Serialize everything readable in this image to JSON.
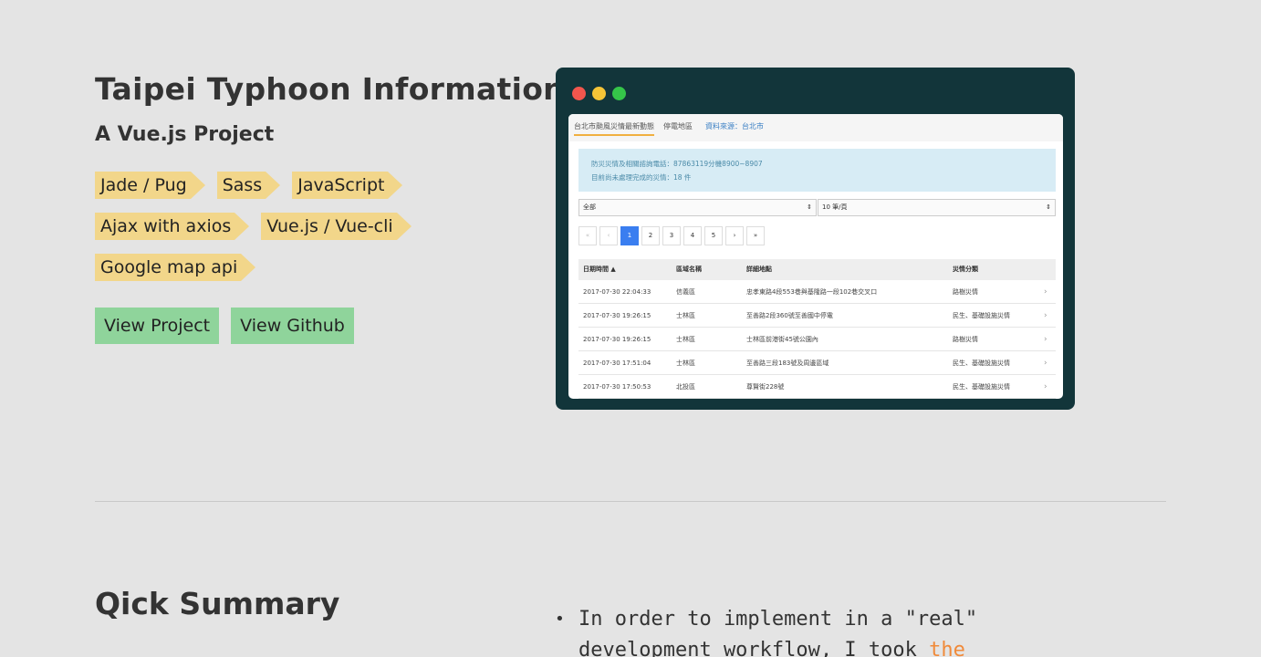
{
  "project": {
    "title": "Taipei Typhoon Information",
    "subtitle": "A Vue.js Project",
    "tags": [
      [
        "Jade / Pug",
        "Sass",
        "JavaScript"
      ],
      [
        "Ajax with axios",
        "Vue.js / Vue-cli"
      ],
      [
        "Google map api"
      ]
    ],
    "buttons": {
      "view_project": "View Project",
      "view_github": "View Github"
    }
  },
  "preview": {
    "nav": {
      "tab1": "台北市颱風災情最新動態",
      "tab2": "停電地區",
      "tab3": "資料來源：台北市"
    },
    "alert": {
      "line1": "防災災情及相關諮詢電話：87863119分機8900~8907",
      "line2": "目前尚未處理完成的災情：18 件"
    },
    "select_district": "全部",
    "select_per_page": "10 筆/頁",
    "pager": [
      "«",
      "‹",
      "1",
      "2",
      "3",
      "4",
      "5",
      "›",
      "»"
    ],
    "headers": {
      "time": "日期時間 ▲",
      "district": "區域名稱",
      "address": "詳細地點",
      "category": "災情分類"
    },
    "rows": [
      {
        "time": "2017-07-30 22:04:33",
        "district": "信義區",
        "address": "忠孝東路4段553巷與基隆路一段102巷交叉口",
        "category": "路樹災情"
      },
      {
        "time": "2017-07-30 19:26:15",
        "district": "士林區",
        "address": "至善路2段360號至善國中停電",
        "category": "民生、基礎設施災情"
      },
      {
        "time": "2017-07-30 19:26:15",
        "district": "士林區",
        "address": "士林區前港街45號公園內",
        "category": "路樹災情"
      },
      {
        "time": "2017-07-30 17:51:04",
        "district": "士林區",
        "address": "至善路三段183號及周邊區域",
        "category": "民生、基礎設施災情"
      },
      {
        "time": "2017-07-30 17:50:53",
        "district": "北投區",
        "address": "尊賢街228號",
        "category": "民生、基礎設施災情"
      }
    ]
  },
  "summary": {
    "title": "Qick Summary",
    "text_before": "In order to implement in a \"real\" development workflow, I took ",
    "link_text": "the"
  },
  "colors": {
    "tag": "#f2d68a",
    "button": "#8fd49b",
    "window": "#12353a",
    "link": "#f08a3a"
  }
}
